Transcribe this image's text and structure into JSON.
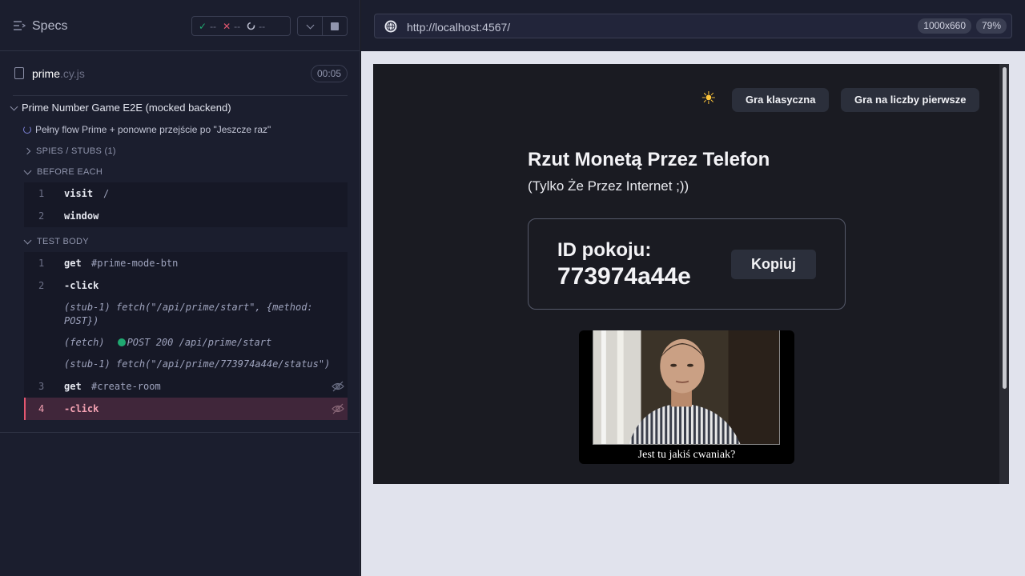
{
  "reporter": {
    "title": "Specs",
    "stats": {
      "passed": "--",
      "failed": "--",
      "pending": "--"
    },
    "file": {
      "name": "prime",
      "ext": ".cy.js",
      "duration": "00:05"
    },
    "suite": "Prime Number Game E2E (mocked backend)",
    "test": "Pełny flow Prime + ponowne przejście po \"Jeszcze raz\"",
    "sections": {
      "spies": "SPIES / STUBS (1)",
      "before_each": "BEFORE EACH",
      "test_body": "TEST BODY"
    },
    "before_each": [
      {
        "num": "1",
        "name": "visit",
        "arg": "/"
      },
      {
        "num": "2",
        "name": "window",
        "arg": ""
      }
    ],
    "test_body": {
      "c1": {
        "num": "1",
        "name": "get",
        "arg": "#prime-mode-btn"
      },
      "c2": {
        "num": "2",
        "name": "-click"
      },
      "s1": "(stub-1)  fetch(\"/api/prime/start\", {method: POST})",
      "f1_prefix": "(fetch)",
      "f1_text": "POST 200 /api/prime/start",
      "s2": "(stub-1)  fetch(\"/api/prime/773974a44e/status\")",
      "c3": {
        "num": "3",
        "name": "get",
        "arg": "#create-room"
      },
      "c4": {
        "num": "4",
        "name": "-click"
      }
    }
  },
  "browser": {
    "url": "http://localhost:4567/",
    "viewport_size": "1000x660",
    "zoom": "79%"
  },
  "app": {
    "theme_icon": "sun-icon",
    "btn_classic": "Gra klasyczna",
    "btn_prime": "Gra na liczby pierwsze",
    "title": "Rzut Monetą Przez Telefon",
    "subtitle": "(Tylko Że Przez Internet ;))",
    "room_label": "ID pokoju:",
    "room_id": "773974a44e",
    "copy_label": "Kopiuj",
    "meme_caption": "Jest tu jakiś cwaniak?"
  },
  "colors": {
    "pass": "#1fa971",
    "fail": "#e45770",
    "active_row": "#40263a",
    "sun": "#ffc63a"
  }
}
